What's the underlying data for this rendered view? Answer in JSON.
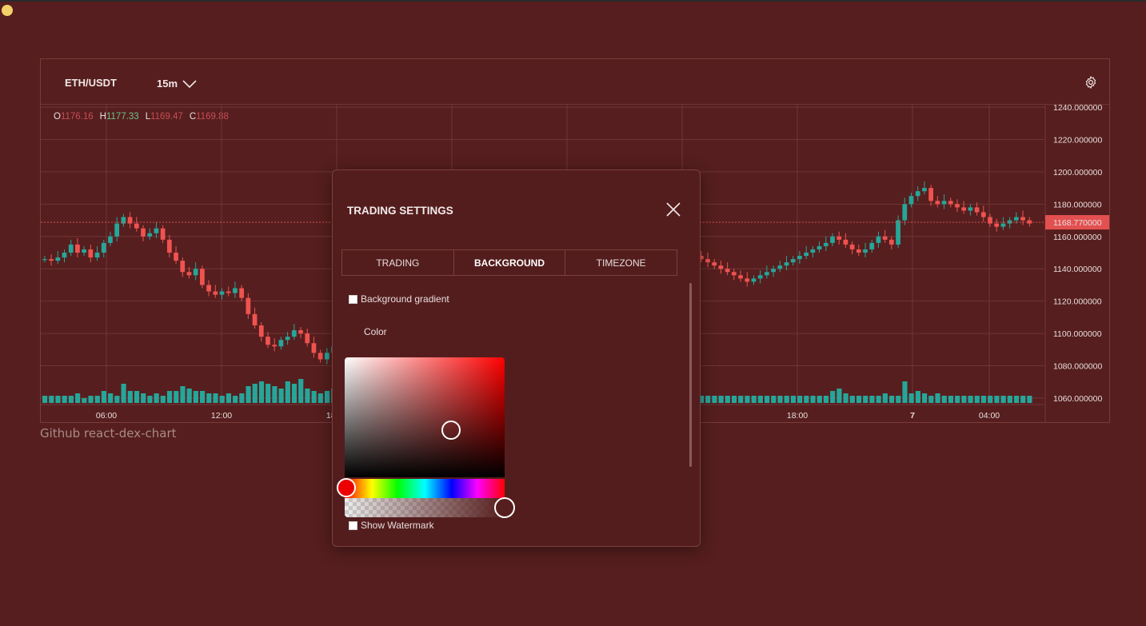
{
  "app": {
    "symbol": "ETH/USDT",
    "interval": "15m",
    "footer_link": "Github react-dex-chart"
  },
  "ohlc": {
    "o_label": "O",
    "o_value": "1176.16",
    "h_label": "H",
    "h_value": "1177.33",
    "l_label": "L",
    "l_value": "1169.47",
    "c_label": "C",
    "c_value": "1169.88"
  },
  "colors": {
    "background": "#561e1e",
    "up": "#26a69a",
    "down": "#ef5350",
    "grid": "#6e3636",
    "last_price_bg": "#e35050"
  },
  "chart_data": {
    "type": "candlestick",
    "price_ticks": [
      "1240.000000",
      "1220.000000",
      "1200.000000",
      "1180.000000",
      "1160.000000",
      "1140.000000",
      "1120.000000",
      "1100.000000",
      "1080.000000",
      "1060.000000"
    ],
    "ylim": [
      1060,
      1240
    ],
    "last_price": "1168.770000",
    "time_ticks": [
      "06:00",
      "12:00",
      "18:00",
      "18:00",
      "7",
      "04:00"
    ],
    "close_series": [
      1146,
      1145,
      1147,
      1150,
      1155,
      1150,
      1152,
      1147,
      1150,
      1156,
      1160,
      1168,
      1172,
      1168,
      1165,
      1160,
      1162,
      1165,
      1158,
      1150,
      1145,
      1138,
      1136,
      1140,
      1130,
      1126,
      1124,
      1126,
      1125,
      1128,
      1122,
      1112,
      1105,
      1098,
      1093,
      1092,
      1096,
      1098,
      1102,
      1100,
      1094,
      1088,
      1084,
      1088,
      1092,
      1095,
      1098,
      1100,
      1102,
      1103,
      1104,
      1106,
      1106,
      1108,
      1110,
      1112,
      1114,
      1116,
      1118,
      1120,
      1122,
      1124,
      1126,
      1128,
      1130,
      1132,
      1134,
      1136,
      1138,
      1140,
      1142,
      1144,
      1146,
      1148,
      1150,
      1148,
      1146,
      1144,
      1142,
      1140,
      1138,
      1136,
      1134,
      1132,
      1134,
      1136,
      1138,
      1140,
      1138,
      1136,
      1134,
      1132,
      1134,
      1136,
      1138,
      1140,
      1142,
      1144,
      1146,
      1148,
      1146,
      1144,
      1142,
      1140,
      1138,
      1136,
      1134,
      1132,
      1134,
      1136,
      1138,
      1140,
      1142,
      1144,
      1146,
      1148,
      1150,
      1152,
      1154,
      1156,
      1160,
      1158,
      1155,
      1152,
      1150,
      1152,
      1156,
      1160,
      1158,
      1155,
      1170,
      1180,
      1185,
      1188,
      1190,
      1182,
      1180,
      1182,
      1180,
      1178,
      1176,
      1178,
      1175,
      1172,
      1168,
      1166,
      1168,
      1170,
      1172,
      1170,
      1168
    ],
    "volume_series": [
      3,
      3,
      3,
      3,
      3,
      4,
      2,
      3,
      3,
      5,
      4,
      3,
      8,
      5,
      5,
      4,
      3,
      4,
      3,
      5,
      5,
      7,
      6,
      5,
      5,
      4,
      4,
      3,
      4,
      3,
      4,
      7,
      8,
      9,
      8,
      7,
      6,
      9,
      8,
      10,
      6,
      5,
      4,
      5,
      6,
      4,
      4,
      3,
      4,
      3,
      3,
      3,
      3,
      3,
      3,
      3,
      3,
      3,
      3,
      3,
      3,
      3,
      3,
      3,
      3,
      3,
      3,
      3,
      3,
      3,
      3,
      3,
      3,
      3,
      3,
      3,
      3,
      3,
      3,
      3,
      3,
      3,
      3,
      3,
      3,
      3,
      3,
      3,
      3,
      3,
      3,
      3,
      3,
      3,
      3,
      3,
      3,
      3,
      3,
      3,
      3,
      3,
      3,
      3,
      3,
      3,
      3,
      3,
      3,
      3,
      3,
      3,
      3,
      3,
      3,
      3,
      3,
      3,
      3,
      3,
      5,
      6,
      4,
      3,
      3,
      3,
      3,
      3,
      4,
      3,
      3,
      9,
      4,
      5,
      4,
      3,
      4,
      3,
      3,
      3,
      3,
      3,
      3,
      3,
      3,
      3,
      3,
      3,
      3,
      3,
      3,
      3,
      3,
      3,
      3,
      3,
      2
    ]
  },
  "modal": {
    "title": "TRADING SETTINGS",
    "tabs": [
      {
        "label": "TRADING",
        "active": false
      },
      {
        "label": "BACKGROUND",
        "active": true
      },
      {
        "label": "TIMEZONE",
        "active": false
      }
    ],
    "background_gradient_label": "Background gradient",
    "background_gradient_checked": false,
    "color_label": "Color",
    "picker_hue_color": "#ff0000",
    "show_watermark_label": "Show Watermark",
    "show_watermark_checked": false
  }
}
